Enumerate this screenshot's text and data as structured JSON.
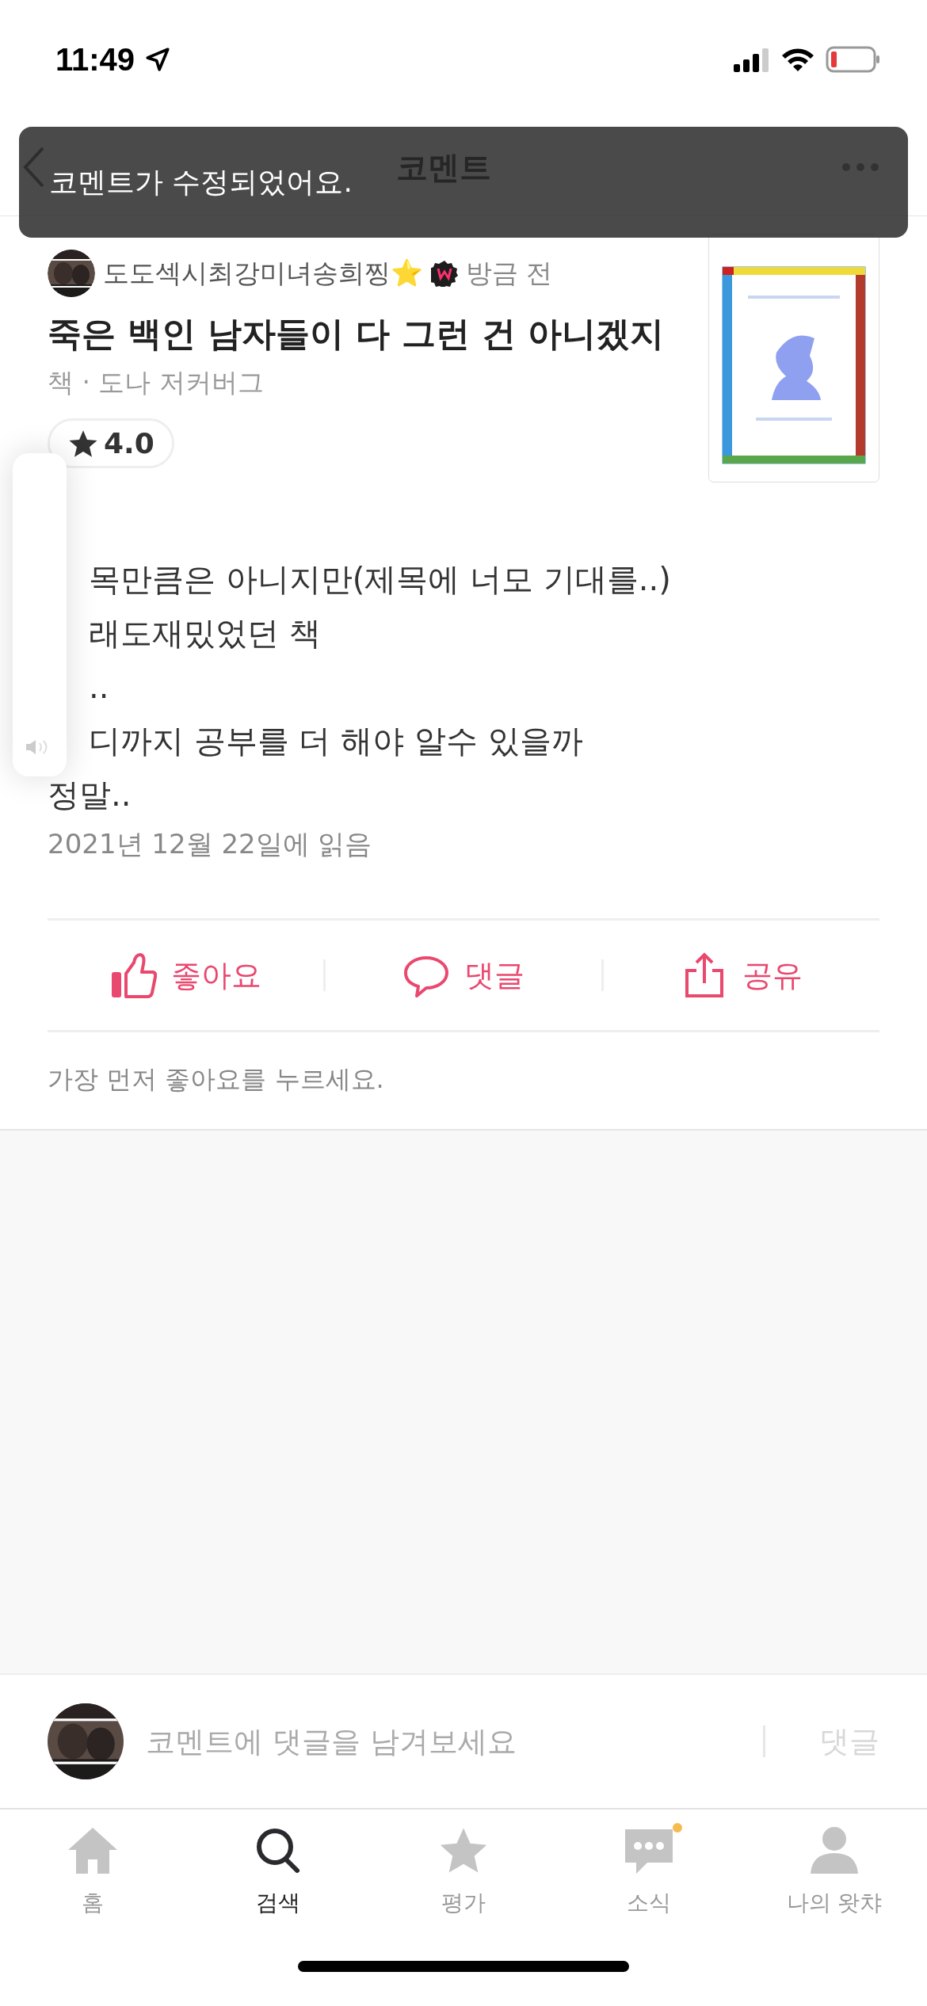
{
  "status_bar": {
    "time": "11:49"
  },
  "header": {
    "title": "코멘트"
  },
  "toast": {
    "message": "코멘트가 수정되었어요."
  },
  "comment": {
    "author": "도도섹시최강미녀송희찡⭐️",
    "time": "방금 전",
    "book_title": "죽은 백인 남자들이 다 그런 건 아니겠지",
    "book_meta": "책 · 도나 저커버그",
    "rating": "4.0",
    "lines": [
      {
        "text": "목만큼은 아니지만(제목에 너모 기대를..)",
        "covered": true
      },
      {
        "text": "래도재밌었던 책",
        "covered": true
      },
      {
        "text": "..",
        "covered": true
      },
      {
        "text": "디까지 공부를 더 해야 알수 있을까",
        "covered": true
      },
      {
        "text": "정말..",
        "covered": false
      }
    ],
    "read_date": "2021년 12월 22일에 읽음"
  },
  "actions": [
    {
      "kind": "like",
      "label": "좋아요"
    },
    {
      "kind": "reply",
      "label": "댓글"
    },
    {
      "kind": "share",
      "label": "공유"
    }
  ],
  "likes_note": "가장 먼저 좋아요를 누르세요.",
  "reply_bar": {
    "placeholder": "코멘트에 댓글을 남겨보세요",
    "button": "댓글"
  },
  "tabs": [
    {
      "kind": "home",
      "label": "홈",
      "selected": false,
      "badge": false
    },
    {
      "kind": "search",
      "label": "검색",
      "selected": true,
      "badge": false
    },
    {
      "kind": "rate",
      "label": "평가",
      "selected": false,
      "badge": false
    },
    {
      "kind": "news",
      "label": "소식",
      "selected": false,
      "badge": true
    },
    {
      "kind": "profile",
      "label": "나의 왓챠",
      "selected": false,
      "badge": false
    }
  ]
}
